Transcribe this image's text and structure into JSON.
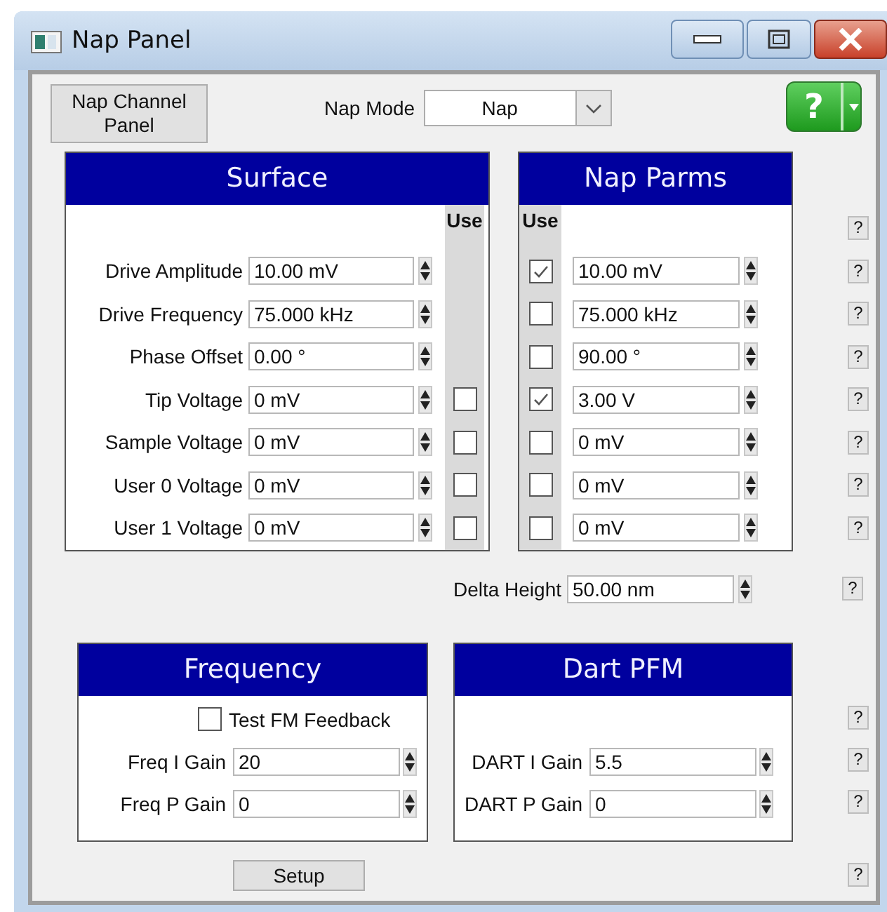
{
  "window": {
    "title": "Nap Panel"
  },
  "toolbar": {
    "channel_button": "Nap Channel Panel",
    "mode_label": "Nap Mode",
    "mode_value": "Nap",
    "help_button": "?"
  },
  "surface": {
    "title": "Surface",
    "use_header": "Use",
    "rows": [
      {
        "kind": "value",
        "label": "Drive Amplitude",
        "value": "10.00 mV"
      },
      {
        "kind": "value",
        "label": "Drive Frequency",
        "value": "75.000 kHz"
      },
      {
        "kind": "value",
        "label": "Phase Offset",
        "value": "0.00 °"
      },
      {
        "kind": "value_use",
        "label": "Tip Voltage",
        "value": "0 mV",
        "checked": false
      },
      {
        "kind": "value_use",
        "label": "Sample Voltage",
        "value": "0 mV",
        "checked": false
      },
      {
        "kind": "value_use",
        "label": "User 0 Voltage",
        "value": "0 mV",
        "checked": false
      },
      {
        "kind": "value_use",
        "label": "User 1 Voltage",
        "value": "0 mV",
        "checked": false
      }
    ]
  },
  "nap_parms": {
    "title": "Nap Parms",
    "use_header": "Use",
    "header_help": "?",
    "rows": [
      {
        "value": "10.00 mV",
        "checked": true,
        "help": "?"
      },
      {
        "value": "75.000 kHz",
        "checked": false,
        "help": "?"
      },
      {
        "value": "90.00 °",
        "checked": false,
        "help": "?"
      },
      {
        "value": "3.00 V",
        "checked": true,
        "help": "?"
      },
      {
        "value": "0 mV",
        "checked": false,
        "help": "?"
      },
      {
        "value": "0 mV",
        "checked": false,
        "help": "?"
      },
      {
        "value": "0 mV",
        "checked": false,
        "help": "?"
      }
    ]
  },
  "delta_height": {
    "label": "Delta Height",
    "value": "50.00 nm",
    "help": "?"
  },
  "frequency": {
    "title": "Frequency",
    "test_fm": {
      "label": "Test FM Feedback",
      "checked": false
    },
    "rows": [
      {
        "label": "Freq I Gain",
        "value": "20"
      },
      {
        "label": "Freq P Gain",
        "value": "0"
      }
    ]
  },
  "dart_pfm": {
    "title": "Dart PFM",
    "rows": [
      {
        "label": "DART I Gain",
        "value": "5.5"
      },
      {
        "label": "DART P Gain",
        "value": "0"
      }
    ]
  },
  "bottom_help": [
    "?",
    "?",
    "?"
  ],
  "setup": {
    "label": "Setup",
    "help": "?"
  }
}
